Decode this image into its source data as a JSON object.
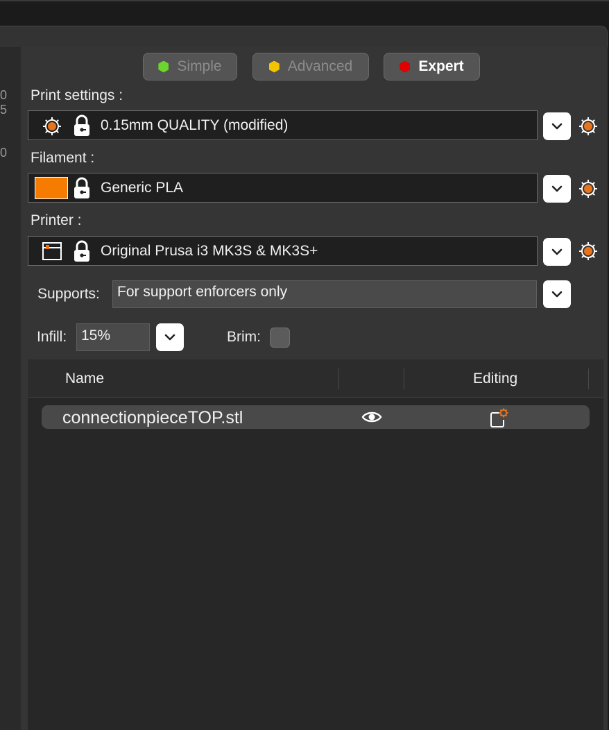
{
  "left_axis": {
    "ticks": [
      "0",
      "5",
      "0"
    ]
  },
  "modes": [
    {
      "label": "Simple",
      "color": "#6bd62b",
      "active": false
    },
    {
      "label": "Advanced",
      "color": "#f2c500",
      "active": false
    },
    {
      "label": "Expert",
      "color": "#e00000",
      "active": true
    }
  ],
  "print_settings": {
    "label": "Print settings :",
    "value": "0.15mm QUALITY (modified)"
  },
  "filament": {
    "label": "Filament :",
    "value": "Generic PLA",
    "color": "#f57c00"
  },
  "printer": {
    "label": "Printer :",
    "value": "Original Prusa i3 MK3S & MK3S+"
  },
  "supports": {
    "label": "Supports:",
    "value": "For support enforcers only"
  },
  "infill": {
    "label": "Infill:",
    "value": "15%"
  },
  "brim": {
    "label": "Brim:",
    "checked": false
  },
  "object_list": {
    "columns": {
      "name": "Name",
      "editing": "Editing"
    },
    "items": [
      {
        "name": "connectionpieceTOP.stl"
      }
    ]
  },
  "icons": {
    "gear": "gear-icon",
    "lock": "lock-icon",
    "chevron": "chevron-down-icon",
    "eye": "eye-icon",
    "edit": "edit-settings-icon"
  },
  "accent": "#e8731a"
}
